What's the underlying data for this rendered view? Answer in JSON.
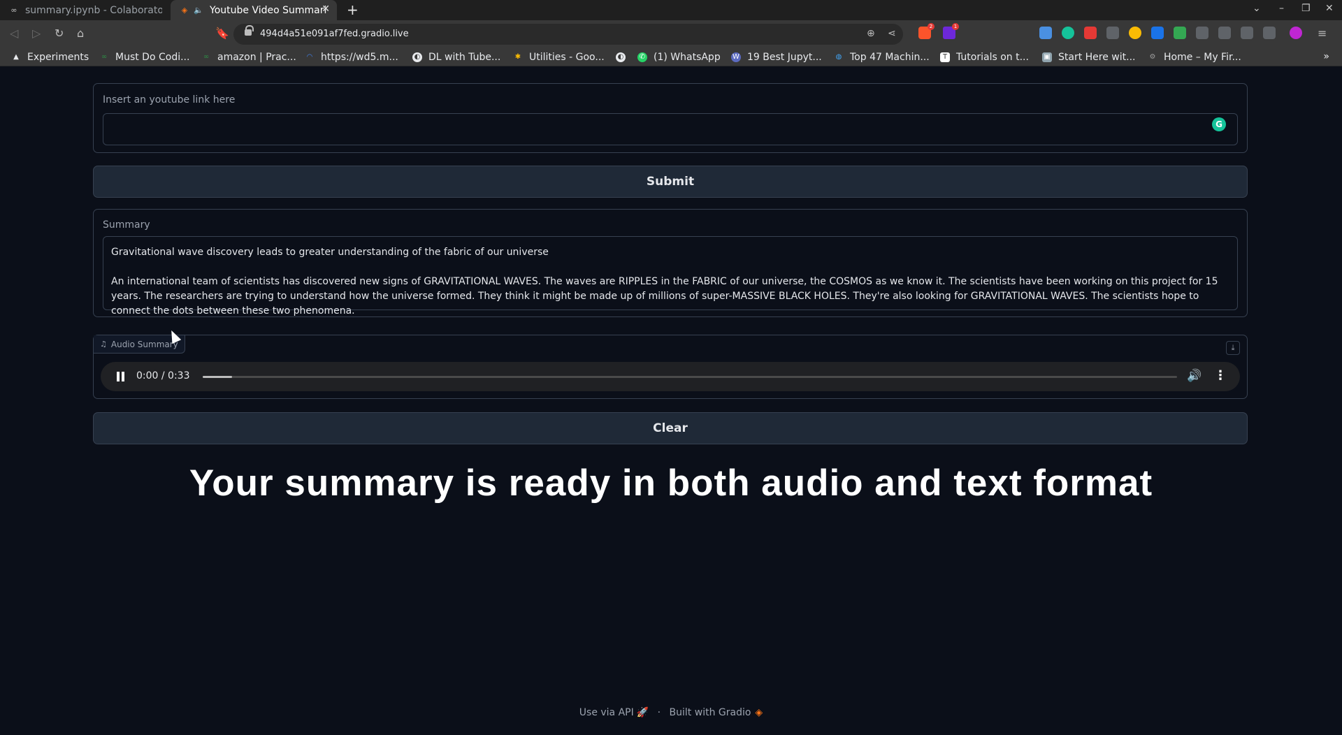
{
  "browser": {
    "tabs": [
      {
        "icon": "colab-icon",
        "title": "summary.ipynb - Colaboratory",
        "active": false
      },
      {
        "icon": "gradio-icon",
        "title": "Youtube Video Summarizer",
        "active": true
      }
    ],
    "new_tab_label": "+",
    "address": "494d4a51e091af7fed.gradio.live",
    "bookmarks": [
      {
        "label": "Experiments",
        "icon": "flask-icon",
        "color": "#e8eaed"
      },
      {
        "label": "Must Do Codi...",
        "icon": "gfg-icon",
        "color": "#2f8d46"
      },
      {
        "label": "amazon | Prac...",
        "icon": "gfg-icon",
        "color": "#2f8d46"
      },
      {
        "label": "https://wd5.m...",
        "icon": "loading-icon",
        "color": "#4285f4"
      },
      {
        "label": "DL with Tube...",
        "icon": "globe-icon",
        "color": "#e8eaed"
      },
      {
        "label": "Utilities - Goo...",
        "icon": "photos-icon",
        "color": "#fbbc04"
      },
      {
        "label": "",
        "icon": "globe-icon",
        "color": "#e8eaed"
      },
      {
        "label": "(1) WhatsApp",
        "icon": "whatsapp-icon",
        "color": "#25d366"
      },
      {
        "label": "19 Best Jupyt...",
        "icon": "site-icon",
        "color": "#5c6bc0"
      },
      {
        "label": "Top 47 Machin...",
        "icon": "site-icon",
        "color": "#42a5f5"
      },
      {
        "label": "Tutorials on t...",
        "icon": "site-icon",
        "color": "#ffffff"
      },
      {
        "label": "Start Here wit...",
        "icon": "site-icon",
        "color": "#90a4ae"
      },
      {
        "label": "Home – My Fir...",
        "icon": "gear-icon",
        "color": "#9e9e9e"
      }
    ],
    "bookmarks_more": "»"
  },
  "app": {
    "input": {
      "label": "Insert an youtube link here",
      "value": "",
      "grammarly_glyph": "G"
    },
    "submit_label": "Submit",
    "summary": {
      "label": "Summary",
      "headline": "Gravitational wave discovery leads to greater understanding of the fabric of our universe",
      "body": "An international team of scientists has discovered new signs of GRAVITATIONAL WAVES. The waves are RIPPLES in the FABRIC of our universe, the COSMOS as we know it. The scientists have been working on this project for 15 years. The researchers are trying to understand how the universe formed. They think it might be made up of millions of super-MASSIVE BLACK HOLES. They're also looking for GRAVITATIONAL WAVES. The scientists hope to connect the dots between these two phenomena."
    },
    "audio": {
      "label": "Audio Summary",
      "time": "0:00 / 0:33",
      "progress": 0.03
    },
    "clear_label": "Clear"
  },
  "banner": "Your summary is ready in both audio and text format",
  "footer": {
    "api_link": "Use via API",
    "separator": "·",
    "built_with": "Built with Gradio"
  }
}
